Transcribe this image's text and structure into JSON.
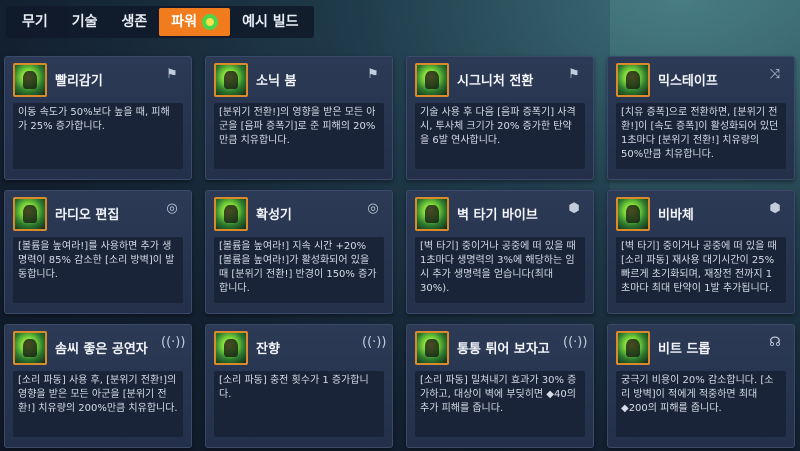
{
  "tabs": [
    {
      "label": "무기"
    },
    {
      "label": "기술"
    },
    {
      "label": "생존"
    },
    {
      "label": "파워"
    },
    {
      "label": "예시 빌드"
    }
  ],
  "cards": [
    {
      "title": "빨리감기",
      "desc": "이동 속도가 50%보다 높을 때, 피해가 25% 증가합니다.",
      "icon": "flag-icon"
    },
    {
      "title": "소닉 붐",
      "desc": "[분위기 전환!]의 영향을 받은 모든 아군을 [음파 증폭기]로 준 피해의 20%만큼 치유합니다.",
      "icon": "flag-icon"
    },
    {
      "title": "시그니처 전환",
      "desc": "기술 사용 후 다음 [음파 증폭기] 사격 시, 투사체 크기가 20% 증가한 탄약을 6발 연사합니다.",
      "icon": "flag-icon"
    },
    {
      "title": "믹스테이프",
      "desc": "[치유 증폭]으로 전환하면, [분위기 전환!]이 [속도 증폭]이 활성화되어 있던 1초마다 [분위기 전환!] 치유량의 50%만큼 치유합니다.",
      "icon": "shuffle-icon"
    },
    {
      "title": "라디오 편집",
      "desc": "[볼륨을 높여라!]를 사용하면 추가 생명력이 85% 감소한 [소리 방벽]이 발동합니다.",
      "icon": "radio-icon"
    },
    {
      "title": "확성기",
      "desc": "[볼륨을 높여라!] 지속 시간 +20% [볼륨을 높여라!]가 활성화되어 있을 때 [분위기 전환!] 반경이 150% 증가합니다.",
      "icon": "radio-icon"
    },
    {
      "title": "벽 타기 바이브",
      "desc": "[벽 타기] 중이거나 공중에 떠 있을 때 1초마다 생명력의 3%에 해당하는 임시 추가 생명력을 얻습니다(최대 30%).",
      "icon": "cube-icon"
    },
    {
      "title": "비바체",
      "desc": "[벽 타기] 중이거나 공중에 떠 있을 때 [소리 파동] 재사용 대기시간이 25% 빠르게 초기화되며, 재장전 전까지 1초마다 최대 탄약이 1발 추가됩니다.",
      "icon": "cube-icon"
    },
    {
      "title": "솜씨 좋은 공연자",
      "desc": "[소리 파동] 사용 후, [분위기 전환!]의 영향을 받은 모든 아군을 [분위기 전환!] 치유량의 200%만큼 치유합니다.",
      "icon": "wave-icon"
    },
    {
      "title": "잔향",
      "desc": "[소리 파동] 충전 횟수가 1 증가합니다.",
      "icon": "wave-icon"
    },
    {
      "title": "통통 튀어 보자고",
      "desc": "[소리 파동] 밀쳐내기 효과가 30% 증가하고, 대상이 벽에 부딪히면 ◆40의 추가 피해를 줍니다.",
      "icon": "wave-icon"
    },
    {
      "title": "비트 드롭",
      "desc": "궁극기 비용이 20% 감소합니다. [소리 방벽]이 적에게 적중하면 최대 ◆200의 피해를 줍니다.",
      "icon": "headset-icon"
    }
  ],
  "colors": {
    "accent": "#f07c1e",
    "card_bg": "#2c3a56",
    "desc_bg": "#1a2438"
  }
}
